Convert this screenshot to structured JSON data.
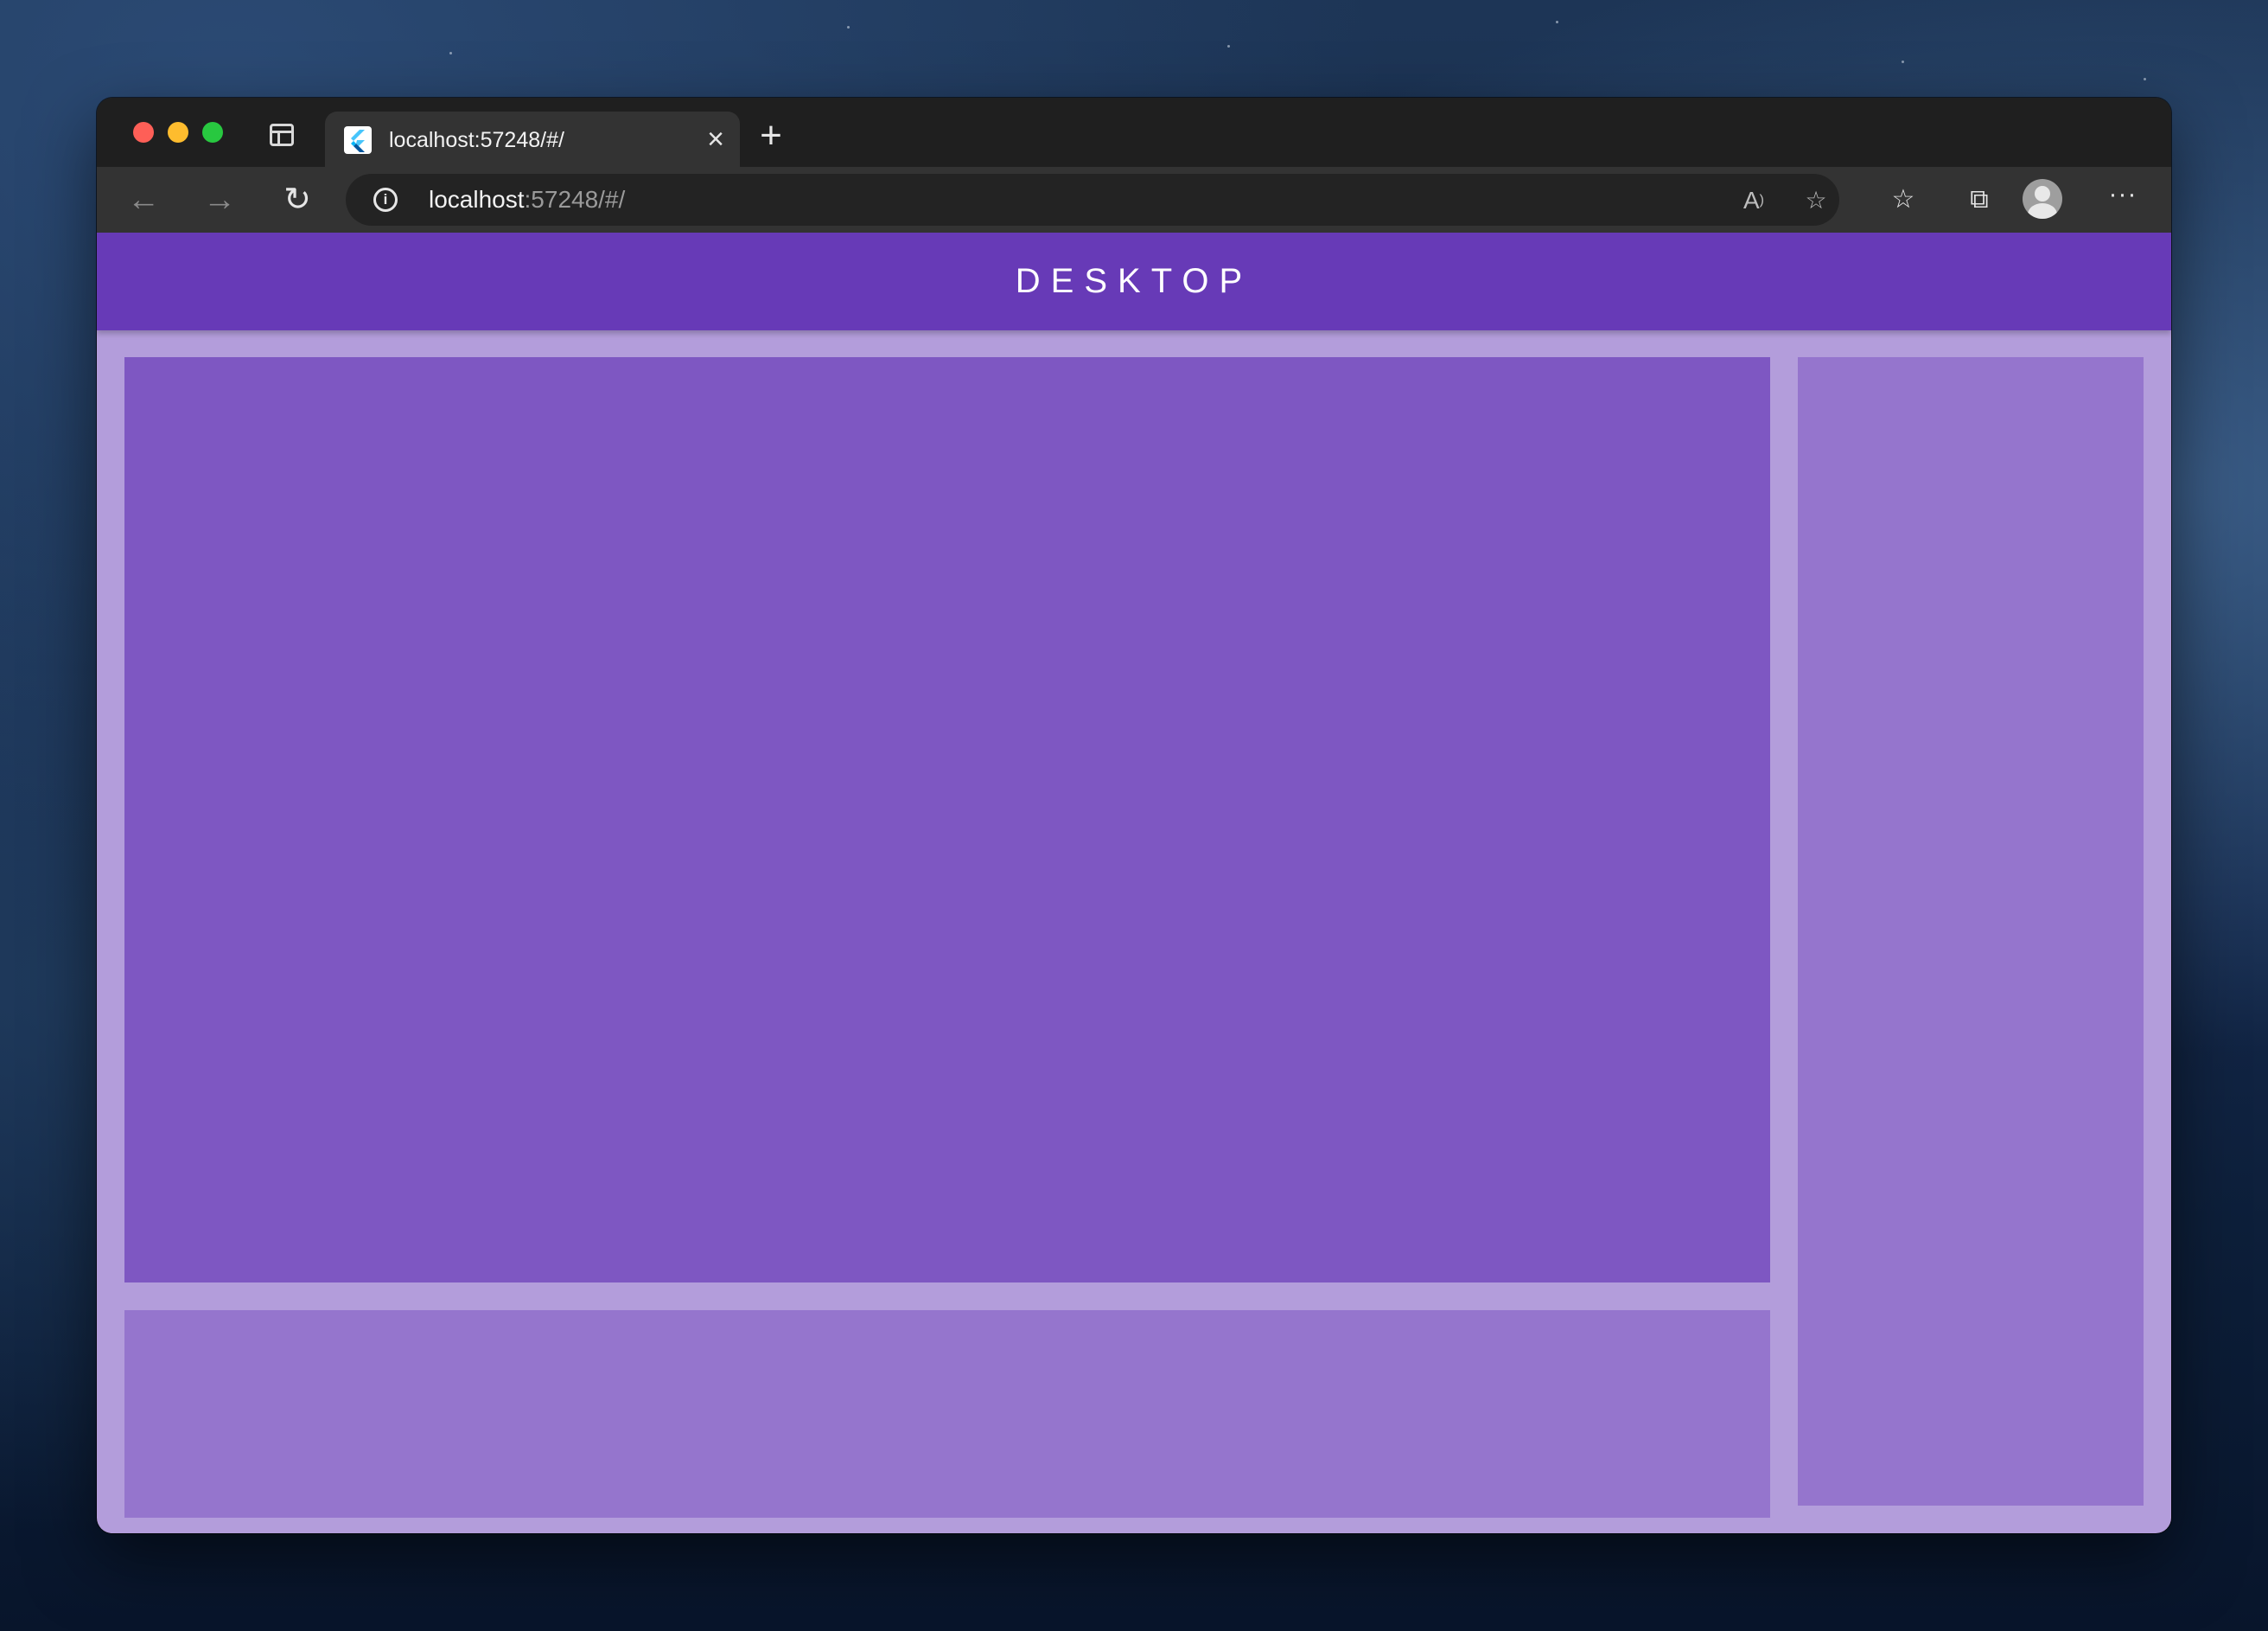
{
  "browser": {
    "tab": {
      "title": "localhost:57248/#/",
      "favicon": "flutter-icon",
      "close_icon": "close-icon"
    },
    "new_tab_icon": "plus-icon",
    "address_bar": {
      "url_host": "localhost",
      "url_rest": ":57248/#/"
    },
    "icons": {
      "back": "arrow-left-icon",
      "forward": "arrow-right-icon",
      "reload": "reload-icon",
      "site_info": "info-icon",
      "read_aloud": "read-aloud-icon",
      "add_favorite": "star-plus-icon",
      "favorites": "favorites-list-icon",
      "collections": "collections-icon",
      "profile": "avatar-icon",
      "more": "more-dots-icon"
    }
  },
  "app": {
    "title": "DESKTOP"
  },
  "colors": {
    "appbar": "#673ab7",
    "background": "#b39ddb",
    "main_panel": "#7e57c2",
    "secondary_panels": "#9575cd"
  }
}
